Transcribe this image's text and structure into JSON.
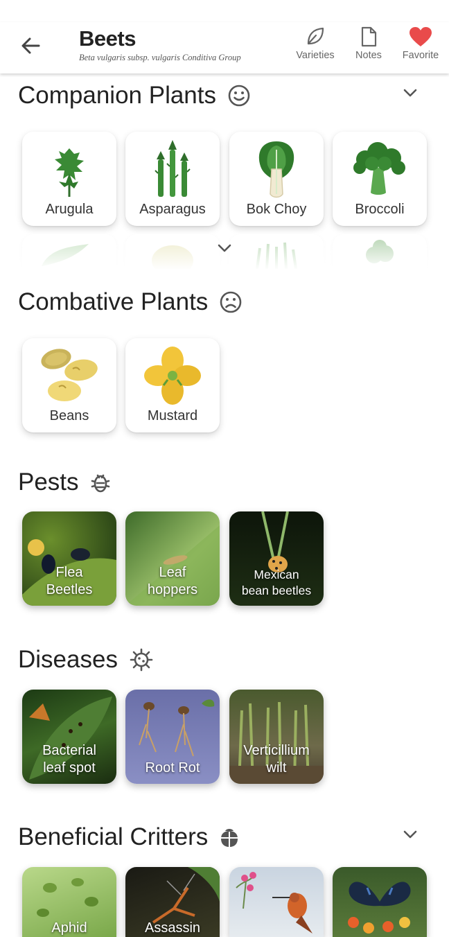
{
  "header": {
    "title": "Beets",
    "subtitle": "Beta vulgaris subsp. vulgaris Conditiva Group",
    "actions": [
      {
        "label": "Varieties",
        "icon": "leaf-icon"
      },
      {
        "label": "Notes",
        "icon": "note-icon"
      },
      {
        "label": "Favorite",
        "icon": "heart-icon"
      }
    ]
  },
  "companion": {
    "title": "Companion Plants",
    "items": [
      "Arugula",
      "Asparagus",
      "Bok Choy",
      "Broccoli"
    ]
  },
  "combative": {
    "title": "Combative Plants",
    "items": [
      "Beans",
      "Mustard"
    ]
  },
  "pests": {
    "title": "Pests",
    "items": [
      {
        "line1": "Flea",
        "line2": "Beetles"
      },
      {
        "line1": "Leaf",
        "line2": "hoppers"
      },
      {
        "line1": "Mexican",
        "line2": "bean beetles"
      }
    ]
  },
  "diseases": {
    "title": "Diseases",
    "items": [
      {
        "line1": "Bacterial",
        "line2": "leaf spot"
      },
      {
        "line1": "",
        "line2": "Root Rot"
      },
      {
        "line1": "Verticillium",
        "line2": "wilt"
      }
    ]
  },
  "beneficial": {
    "title": "Beneficial Critters",
    "items": [
      "Aphid",
      "Assassin",
      "",
      ""
    ]
  },
  "colors": {
    "favorite": "#e94b4b",
    "icon_gray": "#666666",
    "plant_green": "#3a8a35"
  }
}
